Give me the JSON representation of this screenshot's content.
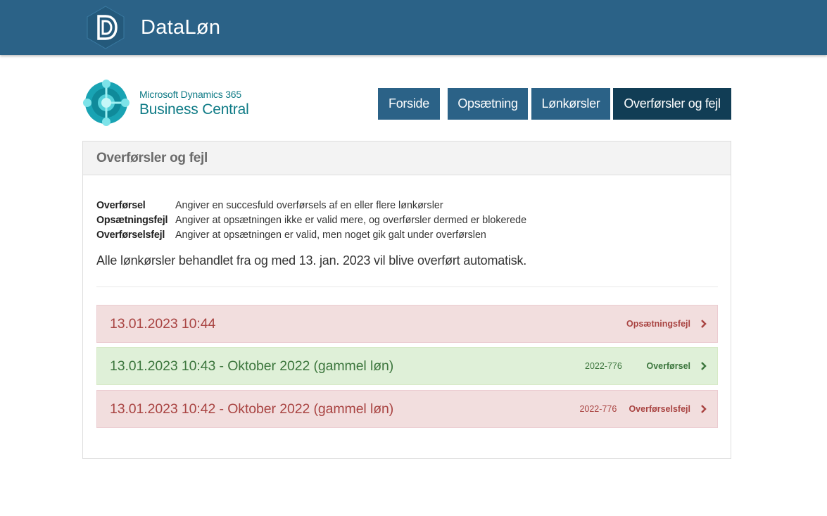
{
  "app": {
    "name": "DataLøn"
  },
  "product": {
    "line1": "Microsoft Dynamics 365",
    "line2": "Business Central"
  },
  "nav": [
    {
      "label": "Forside",
      "active": false
    },
    {
      "label": "Opsætning",
      "active": false
    },
    {
      "label": "Lønkørsler",
      "active": false
    },
    {
      "label": "Overførsler og fejl",
      "active": true
    }
  ],
  "panel": {
    "title": "Overførsler og fejl",
    "legend": [
      {
        "term": "Overførsel",
        "desc": "Angiver en succesfuld overførsels af en eller flere lønkørsler"
      },
      {
        "term": "Opsætningsfejl",
        "desc": "Angiver at opsætningen ikke er valid mere, og overførsler dermed er blokerede"
      },
      {
        "term": "Overførselsfejl",
        "desc": "Angiver at opsætningen er valid, men noget gik galt under overførslen"
      }
    ],
    "notice": "Alle lønkørsler behandlet fra og med 13. jan. 2023 vil blive overført automatisk."
  },
  "entries": [
    {
      "title": "13.01.2023 10:44",
      "code": "",
      "status": "Opsætningsfejl",
      "kind": "error"
    },
    {
      "title": "13.01.2023 10:43 - Oktober 2022 (gammel løn)",
      "code": "2022-776",
      "status": "Overførsel",
      "kind": "success"
    },
    {
      "title": "13.01.2023 10:42 - Oktober 2022 (gammel løn)",
      "code": "2022-776",
      "status": "Overførselsfejl",
      "kind": "error"
    }
  ],
  "icons": {
    "brand": "datalon-logo-icon",
    "product": "business-central-logo-icon",
    "chevron": "chevron-right-icon"
  },
  "colors": {
    "header": "#2b6287",
    "nav": "#2b6287",
    "nav_active": "#113d55",
    "error_bg": "#f2dede",
    "error_text": "#a94442",
    "success_bg": "#dff0d8",
    "success_text": "#3c763d"
  }
}
